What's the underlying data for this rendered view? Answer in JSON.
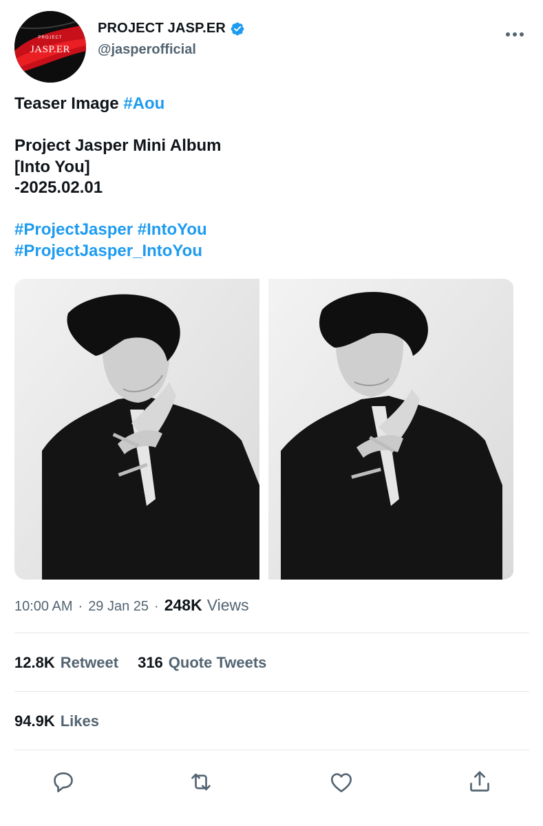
{
  "account": {
    "display_name": "PROJECT JASP.ER",
    "handle": "@jasperofficial",
    "avatar_text": "JASP.ER",
    "avatar_small_text": "PROJECT",
    "verified": true
  },
  "tweet": {
    "lines": [
      {
        "text": "Teaser Image ",
        "tag": "#Aou"
      },
      {
        "text": "",
        "tag": ""
      },
      {
        "text": "Project Jasper Mini Album",
        "tag": ""
      },
      {
        "text": "[Into You]",
        "tag": ""
      },
      {
        "text": "-2025.02.01",
        "tag": ""
      },
      {
        "text": "",
        "tag": ""
      },
      {
        "text": "",
        "tag": "#ProjectJasper #IntoYou"
      },
      {
        "text": "",
        "tag": "#ProjectJasper_IntoYou"
      }
    ]
  },
  "media": {
    "photos": [
      "teaser-photo-1",
      "teaser-photo-2"
    ]
  },
  "meta": {
    "time": "10:00 AM",
    "date": "29 Jan 25",
    "views_count": "248K",
    "views_label": "Views"
  },
  "stats": {
    "retweets_count": "12.8K",
    "retweets_label": "Retweet",
    "quotes_count": "316",
    "quotes_label": "Quote Tweets",
    "likes_count": "94.9K",
    "likes_label": "Likes"
  },
  "actions": [
    "reply-icon",
    "retweet-icon",
    "like-icon",
    "share-icon"
  ],
  "colors": {
    "accent": "#1d9bf0",
    "muted_text": "#536471",
    "primary_text": "#0f1419",
    "divider": "#e1e6ea"
  }
}
